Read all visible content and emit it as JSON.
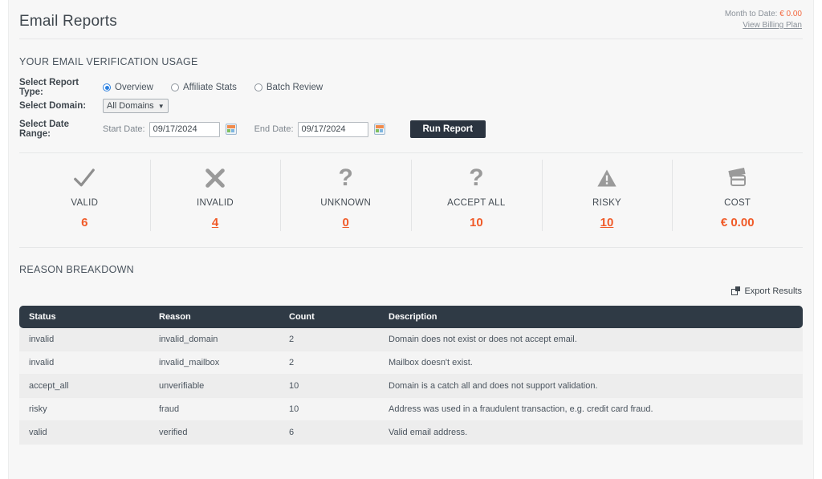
{
  "header": {
    "title": "Email Reports",
    "billing_label": "Month to Date:",
    "billing_amount": "€ 0.00",
    "billing_link": "View Billing Plan"
  },
  "usage_section": {
    "title": "YOUR EMAIL VERIFICATION USAGE"
  },
  "form": {
    "report_type_label": "Select Report Type:",
    "report_types": [
      {
        "label": "Overview",
        "selected": true
      },
      {
        "label": "Affiliate Stats",
        "selected": false
      },
      {
        "label": "Batch Review",
        "selected": false
      }
    ],
    "domain_label": "Select Domain:",
    "domain_value": "All Domains",
    "date_range_label": "Select Date Range:",
    "start_date_label": "Start Date:",
    "start_date_value": "09/17/2024",
    "end_date_label": "End Date:",
    "end_date_value": "09/17/2024",
    "run_button": "Run Report"
  },
  "stats": [
    {
      "label": "VALID",
      "value": "6",
      "icon": "check-icon",
      "is_link": false
    },
    {
      "label": "INVALID",
      "value": "4",
      "icon": "cross-icon",
      "is_link": true
    },
    {
      "label": "UNKNOWN",
      "value": "0",
      "icon": "question-icon",
      "is_link": true
    },
    {
      "label": "ACCEPT ALL",
      "value": "10",
      "icon": "question-icon",
      "is_link": false
    },
    {
      "label": "RISKY",
      "value": "10",
      "icon": "warning-icon",
      "is_link": true
    },
    {
      "label": "COST",
      "value": "€ 0.00",
      "icon": "credit-card-icon",
      "is_link": false
    }
  ],
  "breakdown": {
    "title": "REASON BREAKDOWN",
    "export_label": "Export Results",
    "columns": [
      "Status",
      "Reason",
      "Count",
      "Description"
    ],
    "rows": [
      [
        "invalid",
        "invalid_domain",
        "2",
        "Domain does not exist or does not accept email."
      ],
      [
        "invalid",
        "invalid_mailbox",
        "2",
        "Mailbox doesn't exist."
      ],
      [
        "accept_all",
        "unverifiable",
        "10",
        "Domain is a catch all and does not support validation."
      ],
      [
        "risky",
        "fraud",
        "10",
        "Address was used in a fraudulent transaction, e.g. credit card fraud."
      ],
      [
        "valid",
        "verified",
        "6",
        "Valid email address."
      ]
    ]
  },
  "colors": {
    "accent_orange": "#f05a28",
    "dark_header": "#2f3a45",
    "radio_blue": "#2a7fe0"
  }
}
